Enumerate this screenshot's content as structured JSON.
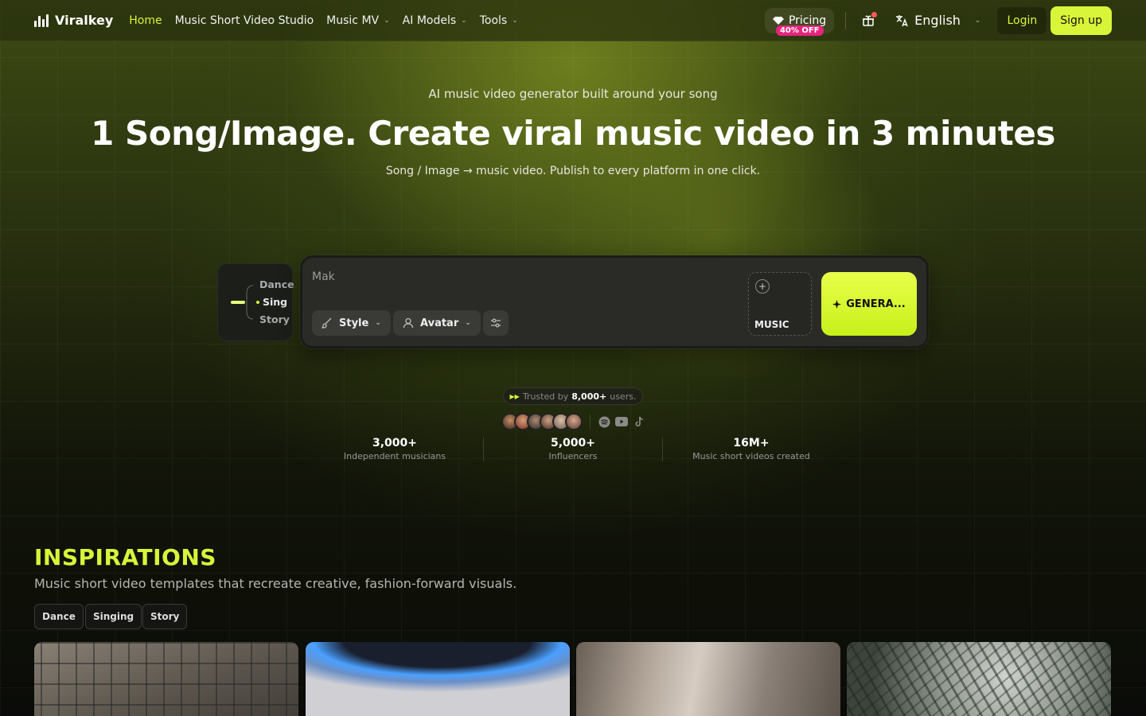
{
  "brand": {
    "name": "Viralkey"
  },
  "nav": {
    "links": [
      {
        "label": "Home",
        "active": true,
        "dropdown": false
      },
      {
        "label": "Music Short Video Studio",
        "active": false,
        "dropdown": false
      },
      {
        "label": "Music MV",
        "active": false,
        "dropdown": true
      },
      {
        "label": "AI Models",
        "active": false,
        "dropdown": true
      },
      {
        "label": "Tools",
        "active": false,
        "dropdown": true
      }
    ],
    "pricing": {
      "label": "Pricing",
      "badge": "40% OFF"
    },
    "language": "English",
    "login": "Login",
    "signup": "Sign up"
  },
  "hero": {
    "eyebrow": "AI music video generator built around your song",
    "title": "1 Song/Image. Create viral music video in 3 minutes",
    "subtitle": "Song / Image → music video. Publish to every platform in one click."
  },
  "modes": {
    "items": [
      "Dance",
      "Sing",
      "Story"
    ],
    "selected": "Sing"
  },
  "prompt": {
    "typed_text": "Mak",
    "style_label": "Style",
    "avatar_label": "Avatar",
    "music_label": "MUSIC",
    "generate_label": "GENERA..."
  },
  "trust": {
    "prefix": "Trusted by",
    "count": "8,000+",
    "suffix": "users."
  },
  "stats": [
    {
      "value": "3,000+",
      "label": "Independent musicians"
    },
    {
      "value": "5,000+",
      "label": "Influencers"
    },
    {
      "value": "16M+",
      "label": "Music short videos created"
    }
  ],
  "inspirations": {
    "title": "INSPIRATIONS",
    "subtitle": "Music short video templates that recreate creative, fashion-forward visuals.",
    "tags": [
      "Dance",
      "Singing",
      "Story"
    ]
  },
  "colors": {
    "accent": "#d8f53a",
    "badge": "#e6247e",
    "panel": "#2a2b27"
  }
}
